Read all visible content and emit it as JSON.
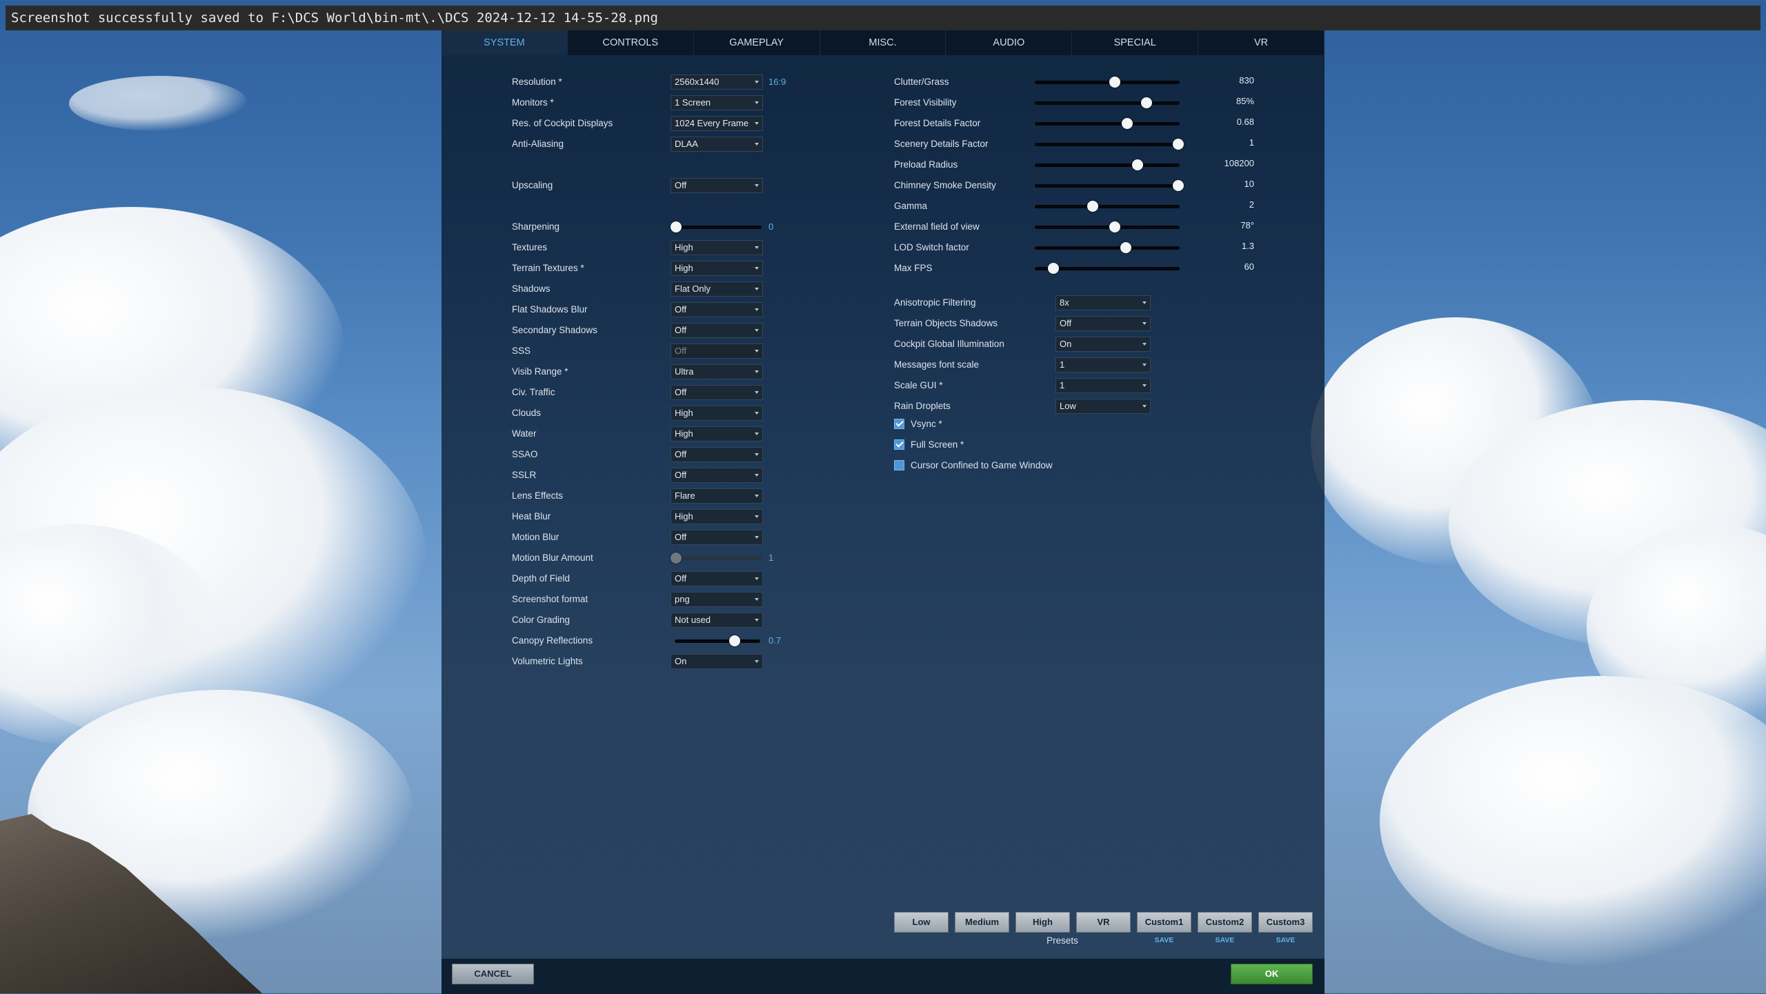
{
  "notification": "Screenshot successfully saved to F:\\DCS World\\bin-mt\\.\\DCS 2024-12-12 14-55-28.png",
  "tabs": [
    "SYSTEM",
    "CONTROLS",
    "GAMEPLAY",
    "MISC.",
    "AUDIO",
    "SPECIAL",
    "VR"
  ],
  "active_tab": "SYSTEM",
  "left": {
    "resolution": {
      "label": "Resolution *",
      "value": "2560x1440",
      "aspect": "16:9"
    },
    "monitors": {
      "label": "Monitors *",
      "value": "1 Screen"
    },
    "cockpit_res": {
      "label": "Res. of Cockpit Displays",
      "value": "1024 Every Frame"
    },
    "anti_aliasing": {
      "label": "Anti-Aliasing",
      "value": "DLAA"
    },
    "upscaling": {
      "label": "Upscaling",
      "value": "Off"
    },
    "sharpening": {
      "label": "Sharpening",
      "value": "0",
      "fraction": 0.0
    },
    "textures": {
      "label": "Textures",
      "value": "High"
    },
    "terrain_textures": {
      "label": "Terrain Textures *",
      "value": "High"
    },
    "shadows": {
      "label": "Shadows",
      "value": "Flat Only"
    },
    "flat_shadows_blur": {
      "label": "Flat Shadows Blur",
      "value": "Off"
    },
    "secondary_shadows": {
      "label": "Secondary Shadows",
      "value": "Off"
    },
    "sss": {
      "label": "SSS",
      "value": "Off"
    },
    "visib_range": {
      "label": "Visib Range *",
      "value": "Ultra"
    },
    "civ_traffic": {
      "label": "Civ. Traffic",
      "value": "Off"
    },
    "clouds": {
      "label": "Clouds",
      "value": "High"
    },
    "water": {
      "label": "Water",
      "value": "High"
    },
    "ssao": {
      "label": "SSAO",
      "value": "Off"
    },
    "sslr": {
      "label": "SSLR",
      "value": "Off"
    },
    "lens_effects": {
      "label": "Lens Effects",
      "value": "Flare"
    },
    "heat_blur": {
      "label": "Heat Blur",
      "value": "High"
    },
    "motion_blur": {
      "label": "Motion Blur",
      "value": "Off"
    },
    "motion_blur_amount": {
      "label": "Motion Blur Amount",
      "value": "1",
      "fraction": 0.0
    },
    "depth_of_field": {
      "label": "Depth of Field",
      "value": "Off"
    },
    "screenshot_format": {
      "label": "Screenshot format",
      "value": "png"
    },
    "color_grading": {
      "label": "Color Grading",
      "value": "Not used"
    },
    "canopy_reflections": {
      "label": "Canopy Reflections",
      "value": "0.7",
      "fraction": 0.7
    },
    "volumetric_lights": {
      "label": "Volumetric Lights",
      "value": "On"
    }
  },
  "right_sliders": [
    {
      "label": "Clutter/Grass",
      "value": "830",
      "fraction": 0.55
    },
    {
      "label": "Forest Visibility",
      "value": "85%",
      "fraction": 0.77
    },
    {
      "label": "Forest Details Factor",
      "value": "0.68",
      "fraction": 0.64
    },
    {
      "label": "Scenery Details Factor",
      "value": "1",
      "fraction": 0.99
    },
    {
      "label": "Preload Radius",
      "value": "108200",
      "fraction": 0.71
    },
    {
      "label": "Chimney Smoke Density",
      "value": "10",
      "fraction": 0.99
    },
    {
      "label": "Gamma",
      "value": "2",
      "fraction": 0.4
    },
    {
      "label": "External field of view",
      "value": "78°",
      "fraction": 0.55
    },
    {
      "label": "LOD Switch factor",
      "value": "1.3",
      "fraction": 0.63
    },
    {
      "label": "Max FPS",
      "value": "60",
      "fraction": 0.13
    }
  ],
  "right_dropdowns": [
    {
      "label": "Anisotropic Filtering",
      "value": "8x"
    },
    {
      "label": "Terrain Objects Shadows",
      "value": "Off"
    },
    {
      "label": "Cockpit Global Illumination",
      "value": "On"
    },
    {
      "label": "Messages font scale",
      "value": "1"
    },
    {
      "label": "Scale GUI *",
      "value": "1"
    },
    {
      "label": "Rain Droplets",
      "value": "Low"
    }
  ],
  "checkboxes": [
    {
      "label": "Vsync *",
      "checked": true
    },
    {
      "label": "Full Screen *",
      "checked": true
    },
    {
      "label": "Cursor Confined to Game Window",
      "checked": false
    }
  ],
  "presets": {
    "label": "Presets",
    "buttons": [
      "Low",
      "Medium",
      "High",
      "VR",
      "Custom1",
      "Custom2",
      "Custom3"
    ],
    "save_label": "SAVE"
  },
  "footer": {
    "cancel": "CANCEL",
    "ok": "OK"
  },
  "colors": {
    "accent": "#5fb3e8",
    "ok_green": "#4aa040",
    "checkbox_blue": "#4f97d6"
  }
}
